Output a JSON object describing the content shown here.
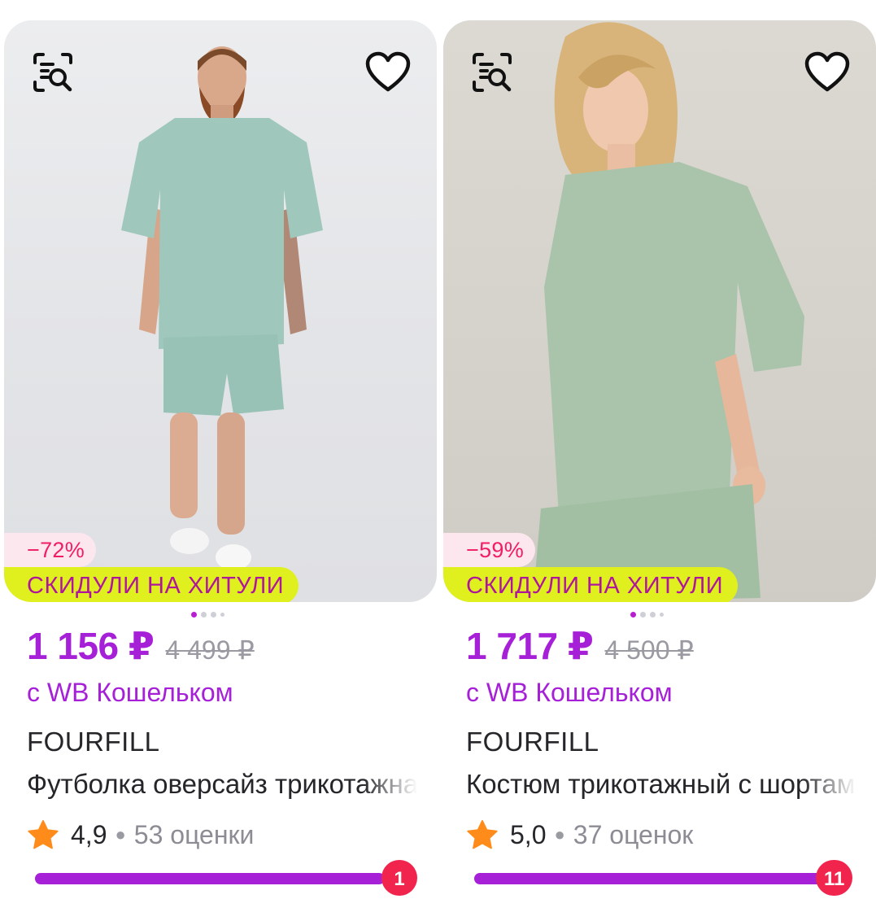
{
  "colors": {
    "accent": "#a620d8",
    "discount_text": "#f01e64",
    "discount_bg": "#fde7ee",
    "promo_bg": "#dff01e",
    "promo_text": "#b0169b",
    "badge": "#f0244d",
    "star": "#ff8b1a"
  },
  "icons": {
    "search": "image-search-icon",
    "favorite": "heart-outline-icon",
    "rating": "star-icon"
  },
  "products": [
    {
      "discount": "−72%",
      "promo": "СКИДУЛИ НА ХИТУЛИ",
      "price": "1 156 ₽",
      "old_price": "4 499 ₽",
      "wallet_note": "с WB Кошельком",
      "brand": "FOURFILL",
      "name": "Футболка оверсайз трикотажная",
      "rating": "4,9",
      "reviews": "53 оценки",
      "cart_count": "1",
      "image_count": 4,
      "active_image": 1
    },
    {
      "discount": "−59%",
      "promo": "СКИДУЛИ НА ХИТУЛИ",
      "price": "1 717 ₽",
      "old_price": "4 500 ₽",
      "wallet_note": "с WB Кошельком",
      "brand": "FOURFILL",
      "name": "Костюм трикотажный с шортами",
      "rating": "5,0",
      "reviews": "37 оценок",
      "cart_count": "11",
      "image_count": 4,
      "active_image": 1
    }
  ]
}
